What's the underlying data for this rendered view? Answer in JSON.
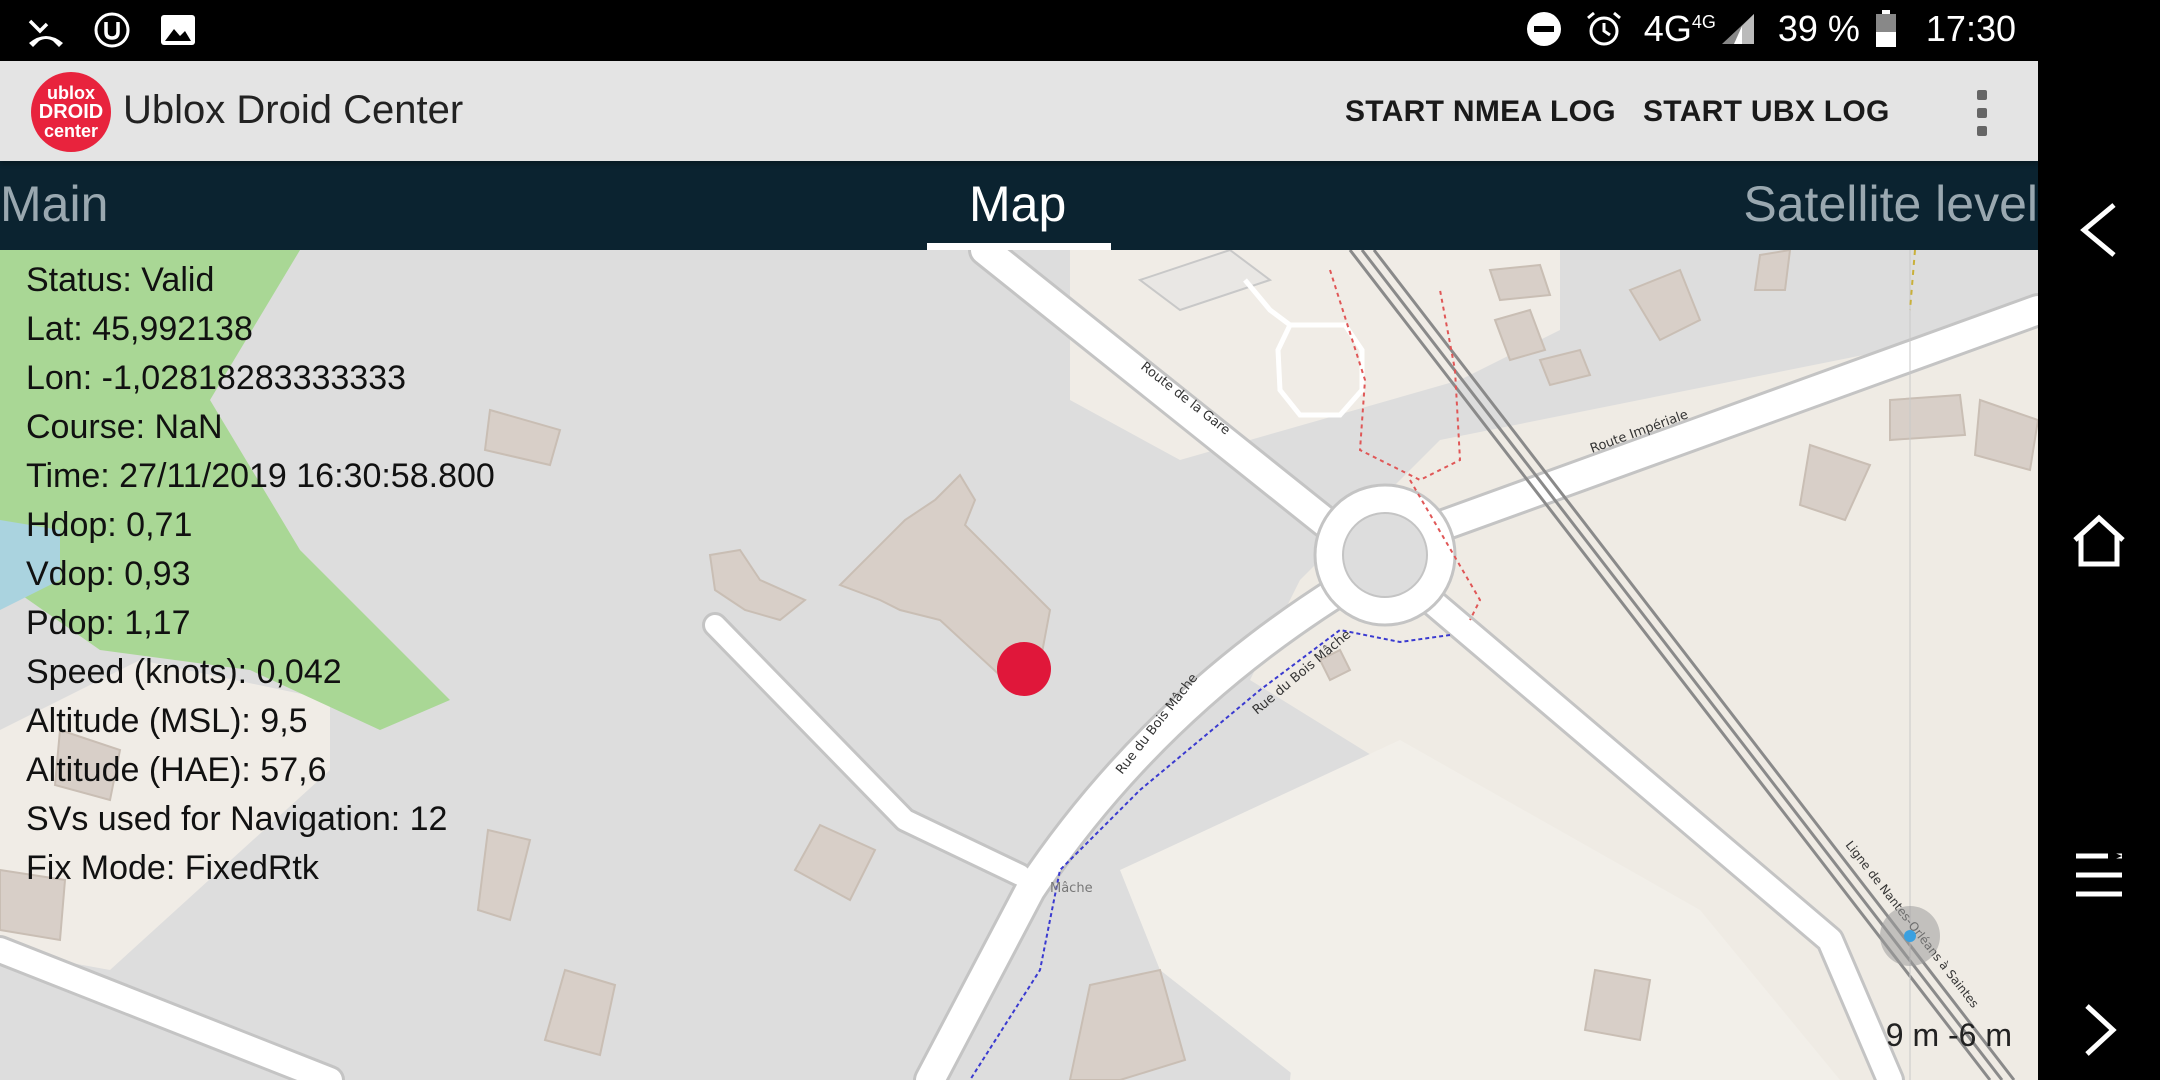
{
  "status_bar": {
    "network": "4G",
    "network_sup": "4G",
    "battery": "39 %",
    "time": "17:30",
    "icons": [
      "missed-call-icon",
      "u-app-icon",
      "image-icon",
      "do-not-disturb-icon",
      "alarm-icon",
      "signal-icon",
      "battery-icon"
    ]
  },
  "app_bar": {
    "logo_lines": [
      "ublox",
      "DROID",
      "center"
    ],
    "title": "Ublox Droid Center",
    "actions": [
      "START NMEA LOG",
      "START UBX LOG"
    ],
    "overflow_icon": "more-vert-icon"
  },
  "tabs": [
    {
      "label": "Main",
      "selected": false
    },
    {
      "label": "Map",
      "selected": true
    },
    {
      "label": "Satellite level",
      "selected": false
    }
  ],
  "info": [
    "Status: Valid",
    "Lat: 45,992138",
    "Lon: -1,02818283333333",
    "Course: NaN",
    "Time: 27/11/2019 16:30:58.800",
    "Hdop: 0,71",
    "Vdop: 0,93",
    "Pdop: 1,17",
    "Speed (knots): 0,042",
    "Altitude (MSL): 9,5",
    "Altitude (HAE): 57,6",
    "SVs used for Navigation: 12",
    "Fix Mode: FixedRtk"
  ],
  "map": {
    "street_labels": [
      "Route de la Gare",
      "Route Impériale",
      "Rue du Bois Mâche",
      "Rue du Bois Mâche",
      "Mâche",
      "Ligne de Nantes-Orléans à Saintes"
    ],
    "position_color": "#e0173a",
    "scale": "9 m -6 m"
  },
  "nav_bar": {
    "icons": [
      "back-icon",
      "home-icon",
      "menu-icon",
      "forward-icon"
    ]
  },
  "colors": {
    "app_bar": "#e4e4e4",
    "tab_bar": "#0b2330",
    "logo": "#e8233d"
  }
}
